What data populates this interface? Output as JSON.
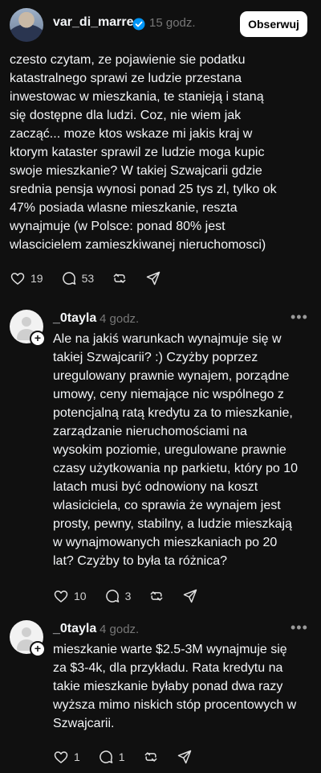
{
  "main_post": {
    "username": "var_di_marre",
    "time": "15 godz.",
    "follow_label": "Obserwuj",
    "text": "czesto czytam, ze pojawienie sie podatku\nkatastralnego sprawi ze ludzie przestana\ninwestowac w mieszkania, te stanieją i staną\nsię dostępne dla ludzi. Coz, nie wiem jak\nzacząć... moze ktos wskaze mi jakis kraj w\nktorym kataster sprawil ze ludzie moga kupic\nswoje mieszkanie? W takiej Szwajcarii gdzie\nsrednia pensja wynosi ponad 25 tys zl, tylko ok\n47% posiada wlasne mieszkanie, reszta\nwynajmuje (w Polsce: ponad 80% jest\nwlascicielem zamieszkiwanej nieruchomosci)",
    "likes": "19",
    "comments": "53"
  },
  "reply1": {
    "username": "_0tayla",
    "time": "4 godz.",
    "more": "•••",
    "text": "Ale na jakiś warunkach wynajmuje się w\ntakiej Szwajcarii? :) Czyżby poprzez\nuregulowany prawnie wynajem, porządne\numowy, ceny niemające nic wspólnego z\npotencjalną ratą kredytu za to mieszkanie,\nzarządzanie nieruchomościami na\nwysokim poziomie, uregulowane prawnie\nczasy użytkowania np parkietu, który po 10\nlatach musi być odnowiony na koszt\nwlasiciciela, co sprawia że wynajem jest\nprosty, pewny, stabilny, a ludzie mieszkają\nw wynajmowanych mieszkaniach po 20\nlat? Czyżby to była ta różnica?",
    "likes": "10",
    "comments": "3"
  },
  "reply2": {
    "username": "_0tayla",
    "time": "4 godz.",
    "more": "•••",
    "text": "mieszkanie warte $2.5-3M wynajmuje się\nza $3-4k, dla przykładu. Rata kredytu na\ntakie mieszkanie byłaby ponad dwa razy\nwyższa mimo niskich stóp procentowych w\nSzwajcarii.",
    "likes": "1",
    "comments": "1"
  },
  "colors": {
    "background": "#101010",
    "text": "#f3f5f7",
    "muted": "#777777",
    "verified": "#0095f6"
  },
  "icons": [
    "heart-icon",
    "comment-icon",
    "repost-icon",
    "share-icon",
    "verified-badge-icon",
    "plus-icon"
  ]
}
